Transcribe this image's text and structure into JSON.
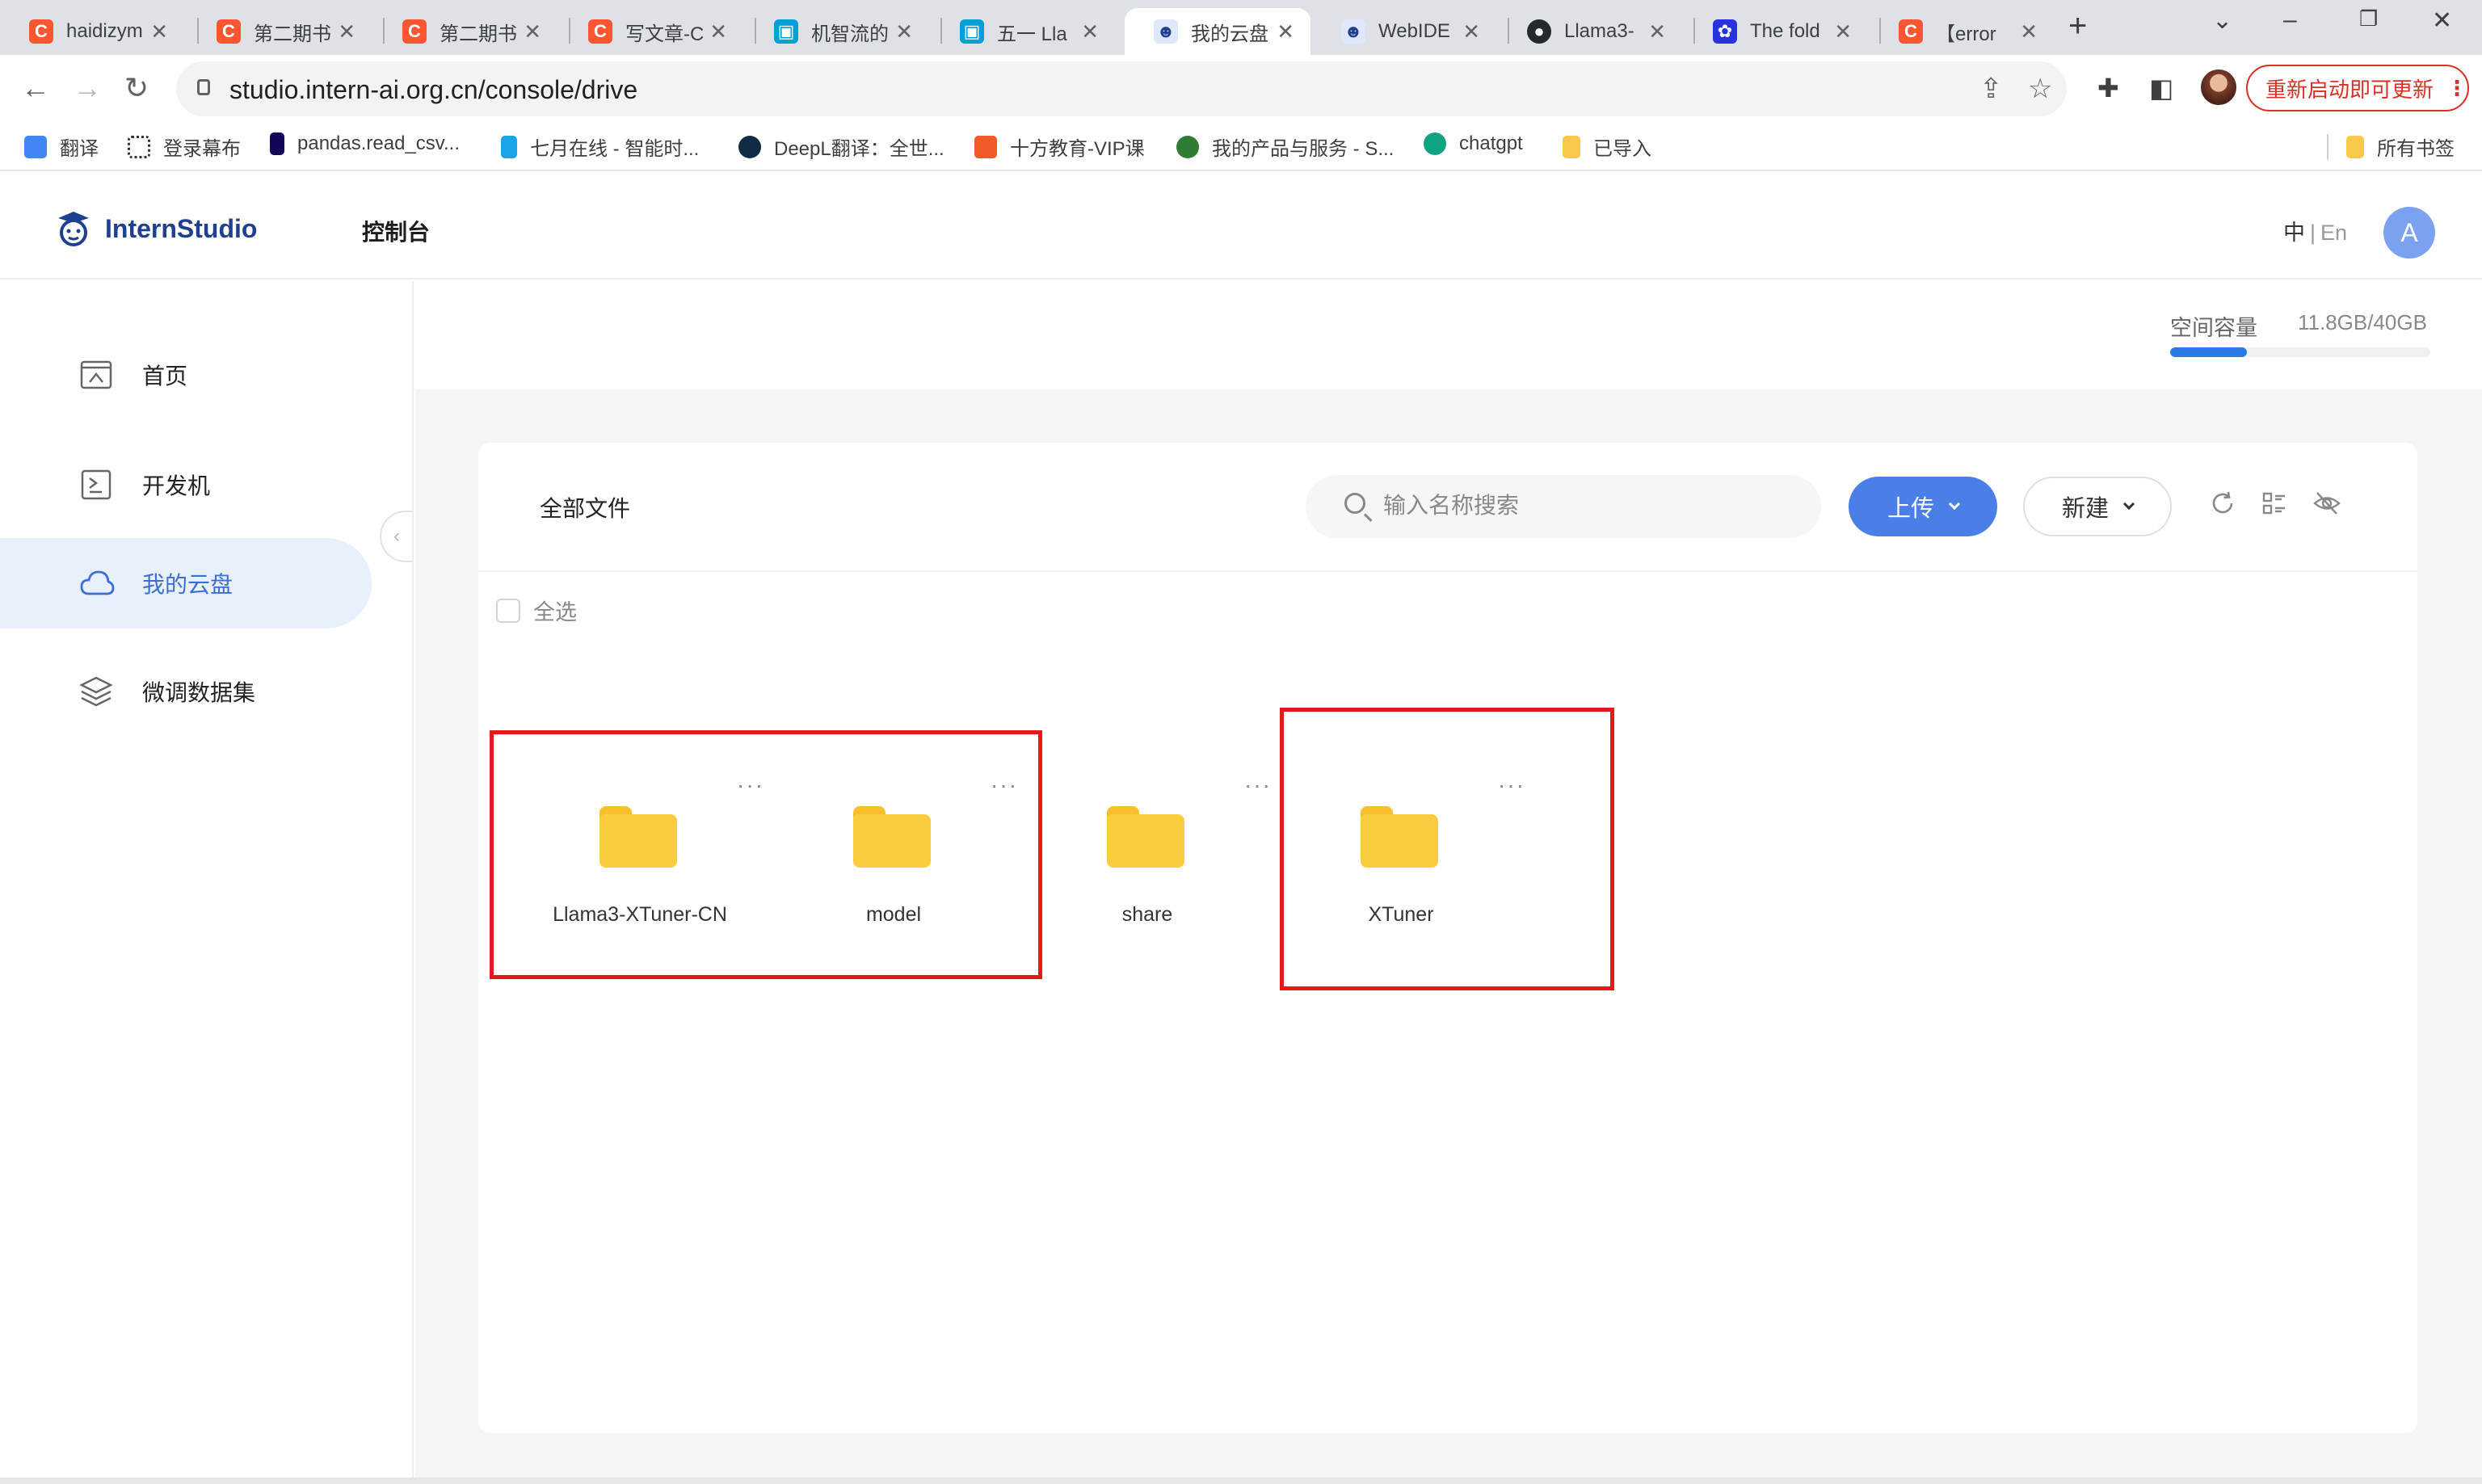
{
  "browser": {
    "tabs": [
      {
        "title": "haidizym",
        "icon": "csdn-icon",
        "color": "#fc5531"
      },
      {
        "title": "第二期书",
        "icon": "csdn-icon",
        "color": "#fc5531"
      },
      {
        "title": "第二期书",
        "icon": "csdn-icon",
        "color": "#fc5531"
      },
      {
        "title": "写文章-C",
        "icon": "csdn-icon",
        "color": "#fc5531"
      },
      {
        "title": "机智流的",
        "icon": "bilibili-icon",
        "color": "#00a1d6"
      },
      {
        "title": "五一 Lla",
        "icon": "bilibili-icon",
        "color": "#00a1d6"
      },
      {
        "title": "我的云盘",
        "icon": "internstudio-icon",
        "color": "#1f3f8f",
        "active": true
      },
      {
        "title": "WebIDE",
        "icon": "internstudio-icon",
        "color": "#1f3f8f"
      },
      {
        "title": "Llama3-",
        "icon": "github-icon",
        "color": "#24292e"
      },
      {
        "title": "The fold",
        "icon": "baidu-icon",
        "color": "#2932e1"
      },
      {
        "title": "【error",
        "icon": "csdn-icon",
        "color": "#fc5531"
      }
    ],
    "url": "studio.intern-ai.org.cn/console/drive",
    "update_button": "重新启动即可更新",
    "bookmarks": [
      {
        "label": "翻译",
        "icon": "google-translate-icon",
        "color": "#4285f4"
      },
      {
        "label": "登录幕布",
        "icon": "mubu-icon",
        "color": "#333333"
      },
      {
        "label": "pandas.read_csv...",
        "icon": "pandas-icon",
        "color": "#150458"
      },
      {
        "label": "七月在线 - 智能时...",
        "icon": "julyedu-icon",
        "color": "#1aa3e8"
      },
      {
        "label": "DeepL翻译：全世...",
        "icon": "deepl-icon",
        "color": "#0f2b46"
      },
      {
        "label": "十方教育-VIP课",
        "icon": "shifang-icon",
        "color": "#f05a28"
      },
      {
        "label": "我的产品与服务 - S...",
        "icon": "product-icon",
        "color": "#2e7d32"
      },
      {
        "label": "chatgpt",
        "icon": "chatgpt-icon",
        "color": "#10a37f"
      },
      {
        "label": "已导入",
        "icon": "folder-icon",
        "color": "#f7c948"
      },
      {
        "label": "所有书签",
        "icon": "folder-icon",
        "color": "#f7c948"
      }
    ]
  },
  "app": {
    "logo_text": "InternStudio",
    "console_title": "控制台",
    "lang_zh": "中",
    "lang_sep": "|",
    "lang_en": "En",
    "avatar_letter": "A"
  },
  "sidebar": {
    "items": [
      {
        "label": "首页",
        "icon": "home-icon"
      },
      {
        "label": "开发机",
        "icon": "terminal-icon"
      },
      {
        "label": "我的云盘",
        "icon": "cloud-icon",
        "active": true
      },
      {
        "label": "微调数据集",
        "icon": "layers-icon"
      }
    ]
  },
  "storage": {
    "label": "空间容量",
    "value": "11.8GB/40GB",
    "used_fraction": 0.295
  },
  "drive": {
    "title": "全部文件",
    "search_placeholder": "输入名称搜索",
    "upload_label": "上传",
    "new_label": "新建",
    "select_all": "全选",
    "files": [
      {
        "name": "Llama3-XTuner-CN"
      },
      {
        "name": "model"
      },
      {
        "name": "share"
      },
      {
        "name": "XTuner"
      }
    ],
    "more_glyph": "···"
  },
  "colors": {
    "accent": "#4a7fe8",
    "folder": "#fbcd3e",
    "highlight": "#e3191a"
  }
}
